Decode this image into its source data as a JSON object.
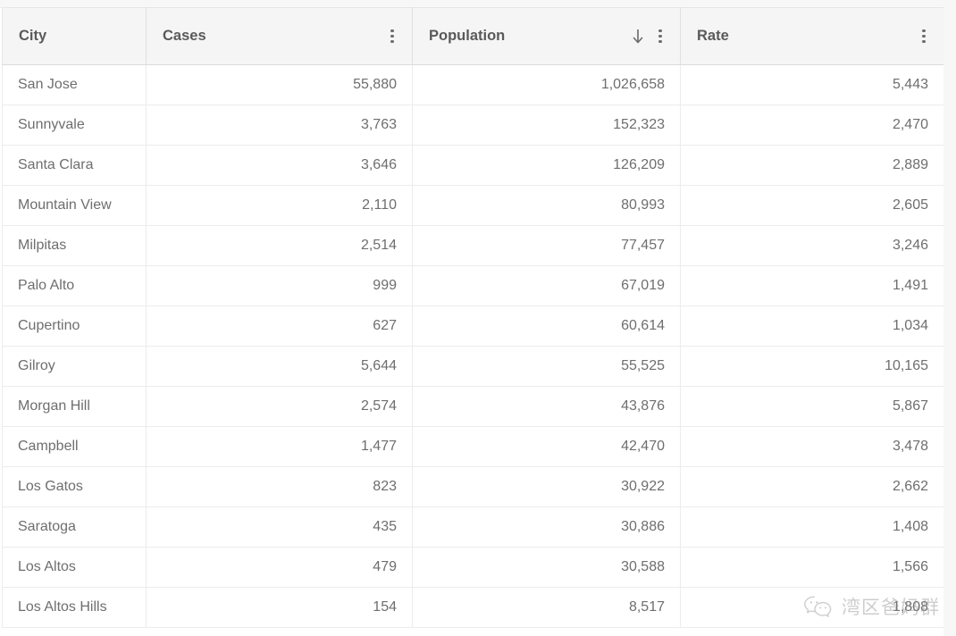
{
  "table": {
    "columns": [
      {
        "key": "city",
        "label": "City",
        "align": "left",
        "sort": "none",
        "menu": false
      },
      {
        "key": "cases",
        "label": "Cases",
        "align": "right",
        "sort": "none",
        "menu": true
      },
      {
        "key": "population",
        "label": "Population",
        "align": "right",
        "sort": "desc",
        "menu": true
      },
      {
        "key": "rate",
        "label": "Rate",
        "align": "right",
        "sort": "none",
        "menu": true
      }
    ],
    "sort_icon": "arrow-down-icon",
    "menu_icon": "kebab-menu-icon",
    "rows": [
      {
        "city": "San Jose",
        "cases": "55,880",
        "population": "1,026,658",
        "rate": "5,443"
      },
      {
        "city": "Sunnyvale",
        "cases": "3,763",
        "population": "152,323",
        "rate": "2,470"
      },
      {
        "city": "Santa Clara",
        "cases": "3,646",
        "population": "126,209",
        "rate": "2,889"
      },
      {
        "city": "Mountain View",
        "cases": "2,110",
        "population": "80,993",
        "rate": "2,605"
      },
      {
        "city": "Milpitas",
        "cases": "2,514",
        "population": "77,457",
        "rate": "3,246"
      },
      {
        "city": "Palo Alto",
        "cases": "999",
        "population": "67,019",
        "rate": "1,491"
      },
      {
        "city": "Cupertino",
        "cases": "627",
        "population": "60,614",
        "rate": "1,034"
      },
      {
        "city": "Gilroy",
        "cases": "5,644",
        "population": "55,525",
        "rate": "10,165"
      },
      {
        "city": "Morgan Hill",
        "cases": "2,574",
        "population": "43,876",
        "rate": "5,867"
      },
      {
        "city": "Campbell",
        "cases": "1,477",
        "population": "42,470",
        "rate": "3,478"
      },
      {
        "city": "Los Gatos",
        "cases": "823",
        "population": "30,922",
        "rate": "2,662"
      },
      {
        "city": "Saratoga",
        "cases": "435",
        "population": "30,886",
        "rate": "1,408"
      },
      {
        "city": "Los Altos",
        "cases": "479",
        "population": "30,588",
        "rate": "1,566"
      },
      {
        "city": "Los Altos Hills",
        "cases": "154",
        "population": "8,517",
        "rate": "1,808"
      }
    ]
  },
  "watermark": {
    "icon": "wechat-logo-icon",
    "text": "湾区爸妈群"
  },
  "colors": {
    "header_bg": "#f5f5f5",
    "header_text": "#5a5a5a",
    "cell_text": "#6e6e6e",
    "border": "#ececec",
    "header_border": "#e0e0e0"
  }
}
